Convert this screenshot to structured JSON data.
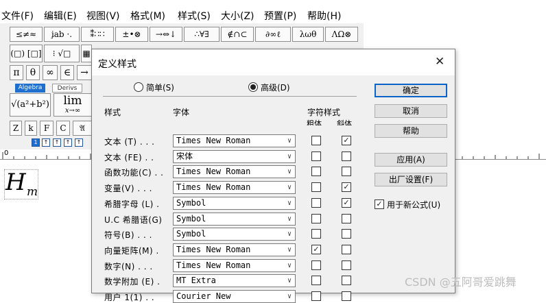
{
  "menu": [
    "文件(F)",
    "编辑(E)",
    "视图(V)",
    "格式(M)",
    "样式(S)",
    "大小(Z)",
    "预置(P)",
    "帮助(H)"
  ],
  "palette": {
    "row1": [
      "≤≠≈",
      "i̧ab ·.",
      "⁑∷∷",
      "±•⊗",
      "→⇔↓",
      "∴∀∃",
      "∉∩⊂",
      "∂∞ℓ",
      "λωθ",
      "ΛΩ⊗"
    ],
    "row2": [
      "(□) [□]",
      "⁝ √□",
      "▦"
    ],
    "row3": [
      "π",
      "θ",
      "∞",
      "∈",
      "→"
    ],
    "tabs": [
      "Algebra",
      "Derivs"
    ],
    "tmpl1": "√(a²+b²)",
    "lim_main": "lim",
    "lim_sub": "x→∞",
    "row5": [
      "Z",
      "k",
      "F",
      "C",
      "𝔄"
    ],
    "small_tools": [
      "1",
      "↑",
      "↑",
      "↑",
      "↑"
    ]
  },
  "ruler": {
    "mark": "0"
  },
  "document": {
    "var_main": "H",
    "var_sub": "m"
  },
  "dialog": {
    "title": "定义样式",
    "close_glyph": "✕",
    "mode_simple": "简单(S)",
    "mode_advanced": "高级(D)",
    "col_style": "样式",
    "col_font": "字体",
    "col_charstyle": "字符样式",
    "col_bold": "粗体",
    "col_italic": "斜体",
    "rows": [
      {
        "label": "文本 (T) . . .",
        "font": "Times New Roman",
        "bold": false,
        "italic": true
      },
      {
        "label": "文本 (FE) . .",
        "font": "宋体",
        "bold": false,
        "italic": false
      },
      {
        "label": "函数功能(C) . .",
        "font": "Times New Roman",
        "bold": false,
        "italic": false
      },
      {
        "label": "变量(V) . . .",
        "font": "Times New Roman",
        "bold": false,
        "italic": true
      },
      {
        "label": "希腊字母 (L) .",
        "font": "Symbol",
        "bold": false,
        "italic": true
      },
      {
        "label": "U.C 希腊语(G)",
        "font": "Symbol",
        "bold": false,
        "italic": false
      },
      {
        "label": "符号(B) . . .",
        "font": "Symbol",
        "bold": false,
        "italic": false
      },
      {
        "label": "向量矩阵(M) .",
        "font": "Times New Roman",
        "bold": true,
        "italic": false
      },
      {
        "label": "数字(N) . . .",
        "font": "Times New Roman",
        "bold": false,
        "italic": false
      },
      {
        "label": "数学附加 (E) .",
        "font": "MT Extra",
        "bold": false,
        "italic": false
      },
      {
        "label": "用户 1(1) . .",
        "font": "Courier New",
        "bold": false,
        "italic": false
      }
    ],
    "buttons": {
      "ok": "确定",
      "cancel": "取消",
      "help": "帮助",
      "apply": "应用(A)",
      "factory": "出厂设置(F)"
    },
    "use_new_label": "用于新公式(U)",
    "use_new_checked": true,
    "check_glyph": "✓"
  },
  "watermark": "CSDN @五阿哥爱跳舞"
}
